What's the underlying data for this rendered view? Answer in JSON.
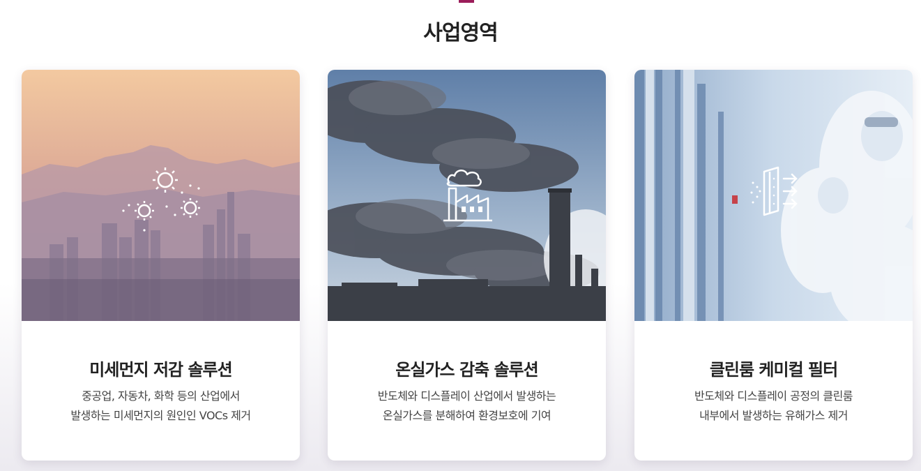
{
  "section": {
    "title": "사업영역"
  },
  "cards": [
    {
      "title": "미세먼지 저감 솔루션",
      "description": [
        "중공업, 자동차, 화학 등의 산업에서",
        "발생하는 미세먼지의 원인인 VOCs 제거"
      ],
      "icon": "sun-dust-icon"
    },
    {
      "title": "온실가스 감축 솔루션",
      "description": [
        "반도체와 디스플레이 산업에서 발생하는",
        "온실가스를 분해하여 환경보호에 기여"
      ],
      "icon": "factory-icon"
    },
    {
      "title": "클린룸 케미컬 필터",
      "description": [
        "반도체와 디스플레이 공정의 클린룸",
        "내부에서 발생하는 유해가스 제거"
      ],
      "icon": "air-filter-icon"
    }
  ],
  "colors": {
    "accent": "#9b1d5a",
    "title_text": "#222222",
    "body_text": "#444444"
  }
}
